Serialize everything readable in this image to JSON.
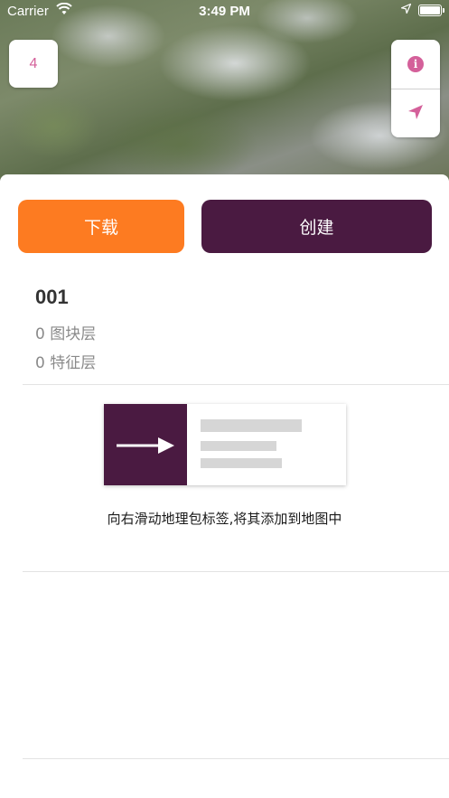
{
  "status_bar": {
    "carrier": "Carrier",
    "time": "3:49 PM"
  },
  "map": {
    "package_count_badge": "4",
    "controls": [
      {
        "name": "info-button",
        "icon": "info-icon"
      },
      {
        "name": "locate-button",
        "icon": "navigation-arrow-icon"
      }
    ]
  },
  "actions": {
    "download_label": "下载",
    "create_label": "创建"
  },
  "package": {
    "name": "001",
    "tile_layers": "0 图块层",
    "feature_layers": "0 特征层"
  },
  "hint": {
    "text": "向右滑动地理包标签,将其添加到地图中"
  },
  "colors": {
    "accent_orange": "#fd7b21",
    "accent_purple": "#4a1a41",
    "icon_pink": "#d4609a"
  }
}
